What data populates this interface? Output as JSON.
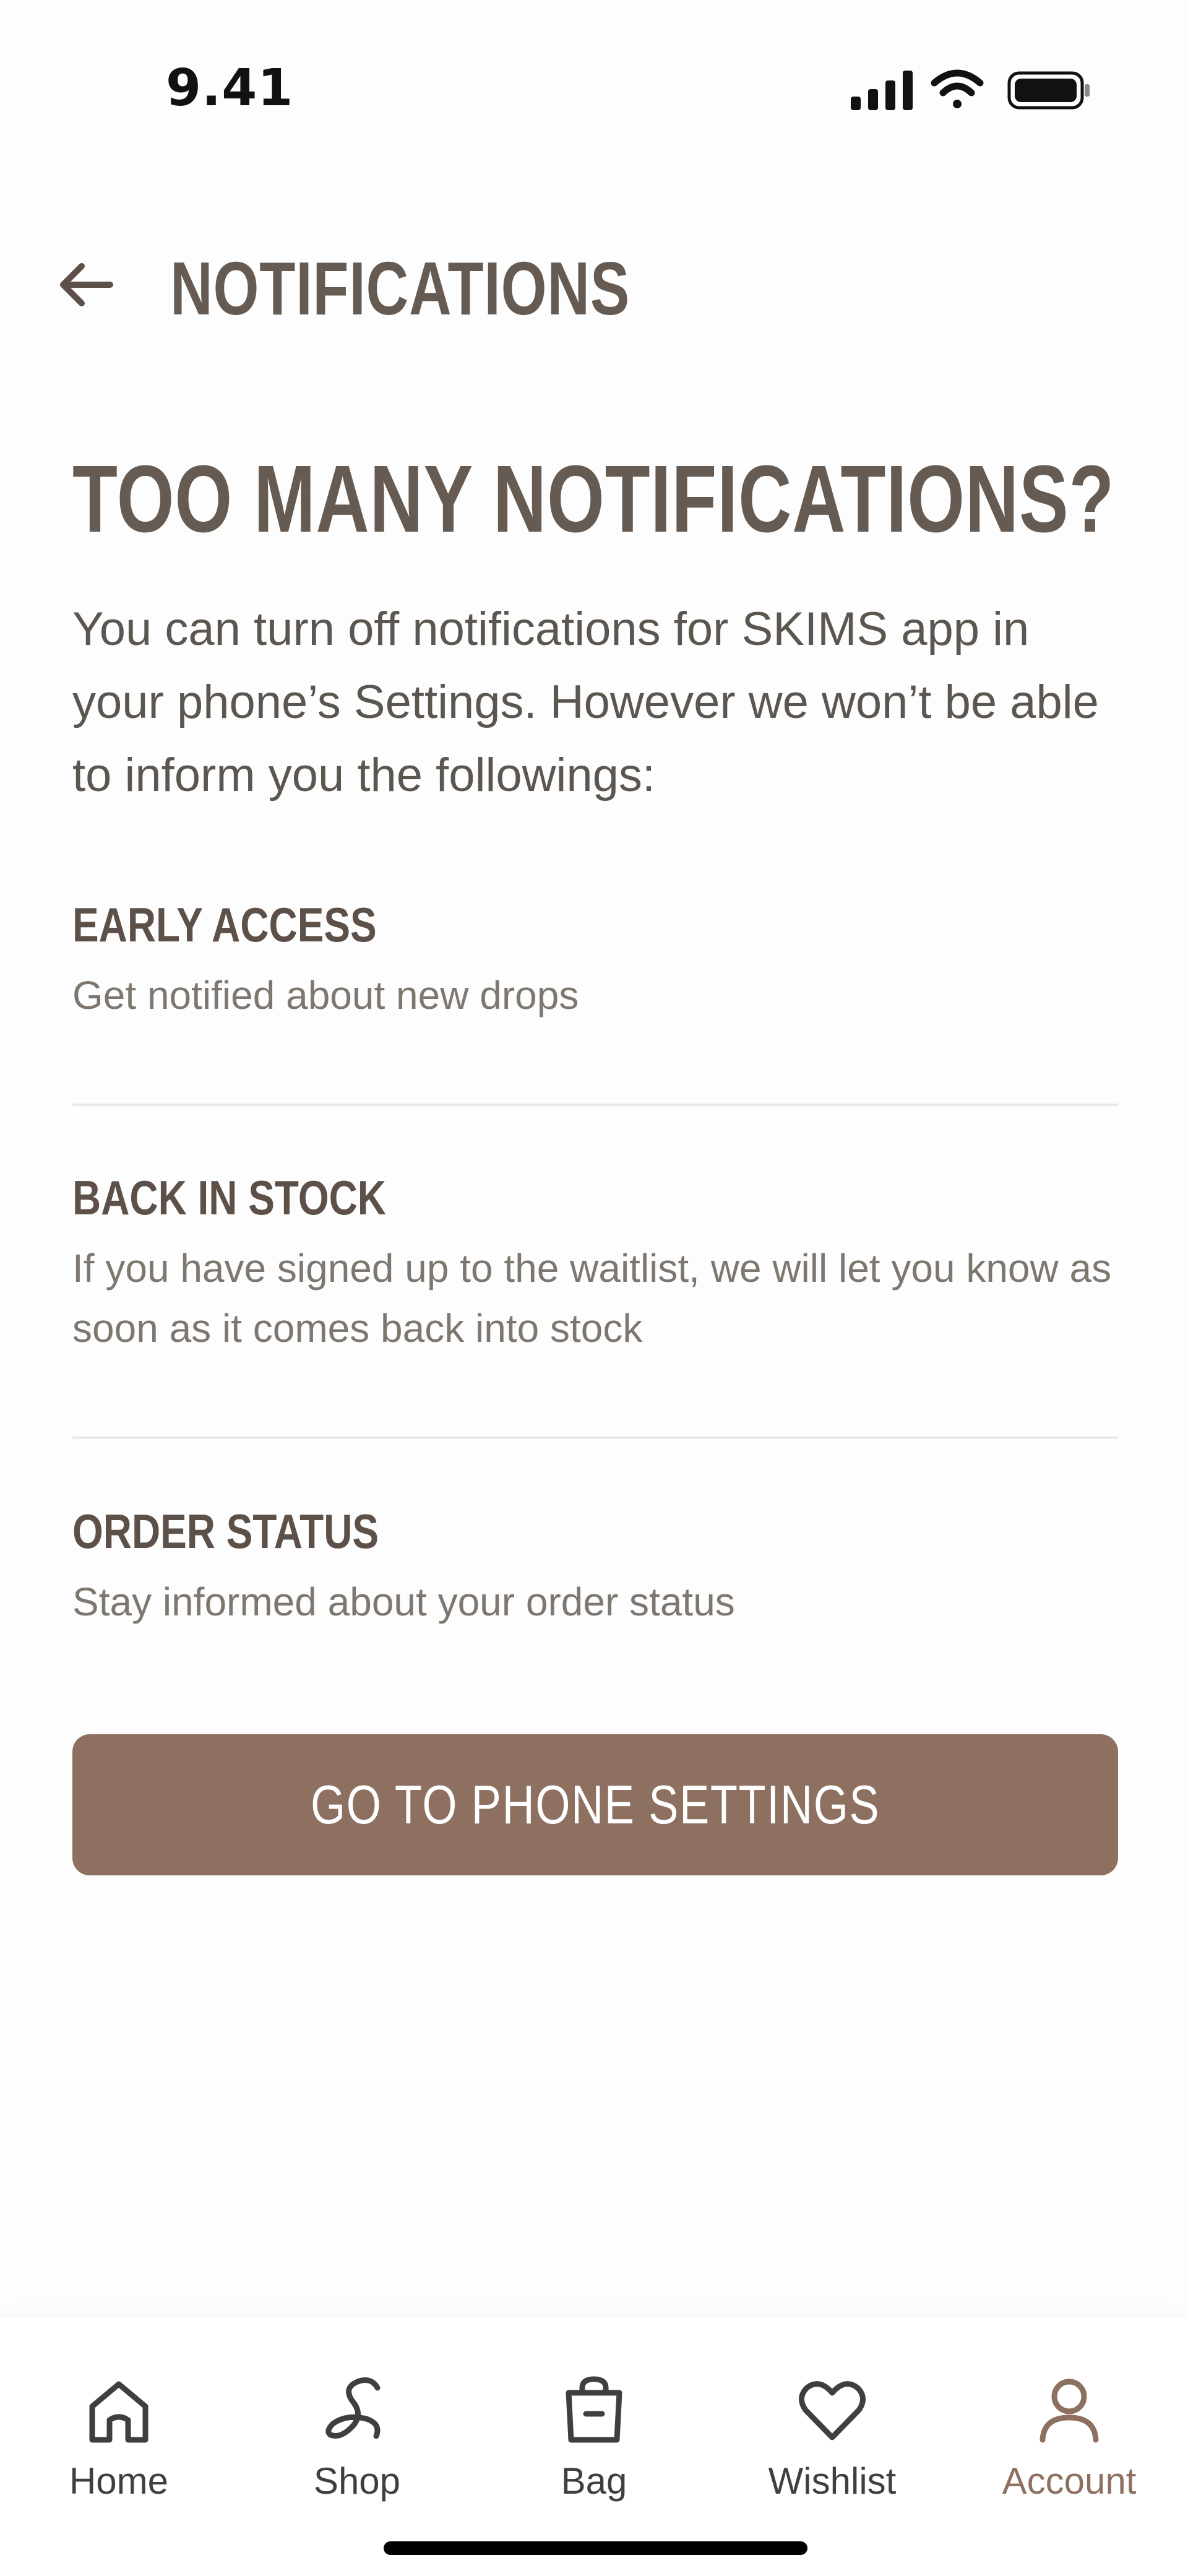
{
  "status_bar": {
    "time": "9.41",
    "icons": [
      "cellular-signal-icon",
      "wifi-icon",
      "battery-icon"
    ]
  },
  "header": {
    "back_icon": "arrow-left-icon",
    "title": "NOTIFICATIONS"
  },
  "hero": {
    "heading": "TOO MANY NOTIFICATIONS?",
    "intro": "You can turn off notifications for SKIMS app in your phone’s Settings. However we won’t be able to inform you the followings:"
  },
  "sections": [
    {
      "title": "EARLY ACCESS",
      "description": "Get notified about new drops"
    },
    {
      "title": "BACK IN STOCK",
      "description": "If you have signed up to the waitlist, we will let you know as soon as it comes back into stock"
    },
    {
      "title": "ORDER STATUS",
      "description": "Stay informed about your order status"
    }
  ],
  "cta": {
    "label": "GO TO PHONE SETTINGS"
  },
  "tab_bar": {
    "items": [
      {
        "label": "Home",
        "icon": "home-icon",
        "active": false
      },
      {
        "label": "Shop",
        "icon": "shop-s-icon",
        "active": false
      },
      {
        "label": "Bag",
        "icon": "bag-icon",
        "active": false
      },
      {
        "label": "Wishlist",
        "icon": "heart-icon",
        "active": false
      },
      {
        "label": "Account",
        "icon": "user-icon",
        "active": true
      }
    ]
  },
  "colors": {
    "text_primary": "#655b52",
    "accent_button": "#8e7061",
    "active_tab": "#8e7061",
    "inactive_tab": "#3f3f3f"
  }
}
